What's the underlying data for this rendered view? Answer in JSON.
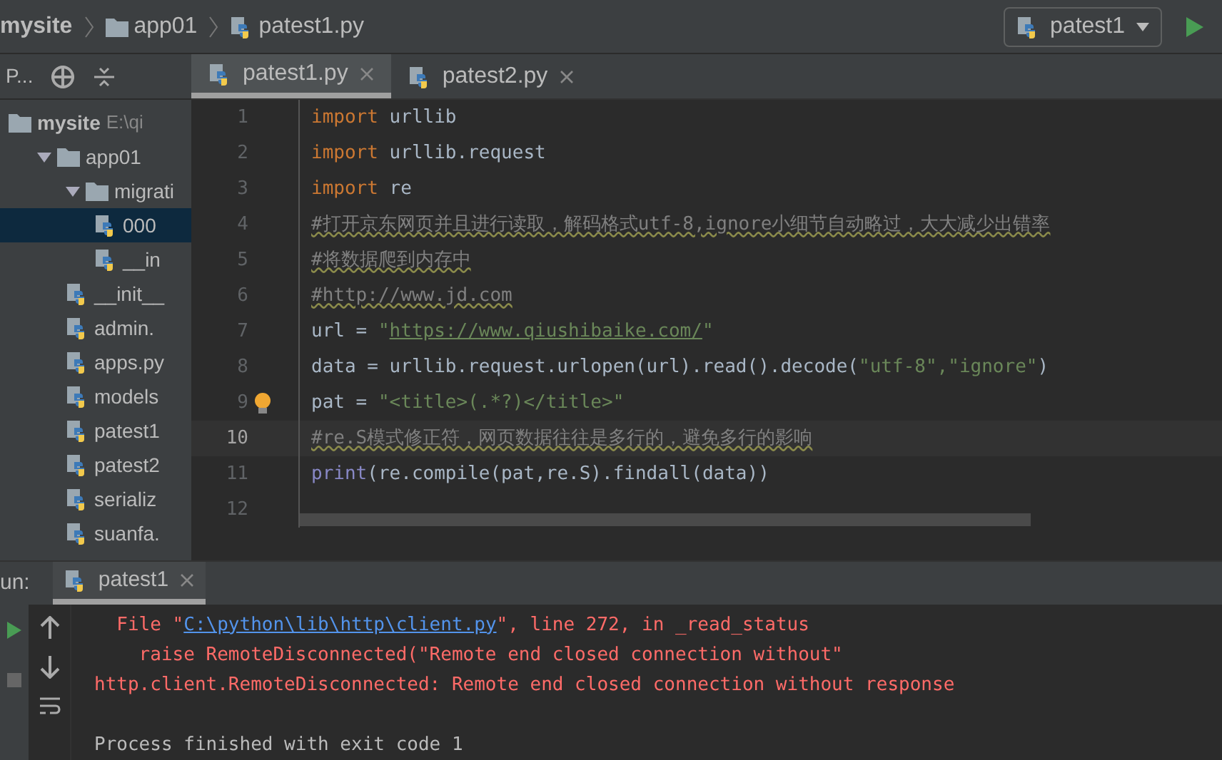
{
  "breadcrumbs": [
    {
      "label": "mysite",
      "kind": "project"
    },
    {
      "label": "app01",
      "kind": "folder"
    },
    {
      "label": "patest1.py",
      "kind": "file"
    }
  ],
  "run_config": {
    "label": "patest1"
  },
  "project_panel": {
    "view_label": "P..."
  },
  "tree": [
    {
      "label": "mysite",
      "path": "E:\\qi",
      "kind": "folder",
      "selected": false,
      "children": [
        {
          "label": "app01",
          "kind": "folder",
          "expanded": true,
          "selected": false,
          "children": [
            {
              "label": "migrati",
              "kind": "folder",
              "expanded": true,
              "selected": false,
              "children": [
                {
                  "label": "000",
                  "kind": "file",
                  "selected": true
                },
                {
                  "label": "__in",
                  "kind": "file",
                  "selected": false
                }
              ]
            },
            {
              "label": "__init__",
              "kind": "file",
              "selected": false
            },
            {
              "label": "admin.",
              "kind": "file",
              "selected": false
            },
            {
              "label": "apps.py",
              "kind": "file",
              "selected": false
            },
            {
              "label": "models",
              "kind": "file",
              "selected": false
            },
            {
              "label": "patest1",
              "kind": "file",
              "selected": false
            },
            {
              "label": "patest2",
              "kind": "file",
              "selected": false
            },
            {
              "label": "serializ",
              "kind": "file",
              "selected": false
            },
            {
              "label": "suanfa.",
              "kind": "file",
              "selected": false
            }
          ]
        }
      ]
    }
  ],
  "editor_tabs": [
    {
      "label": "patest1.py",
      "selected": true
    },
    {
      "label": "patest2.py",
      "selected": false
    }
  ],
  "code": [
    {
      "number": "1",
      "current": false,
      "tokens": [
        {
          "kind": "kw",
          "text": "import"
        },
        {
          "kind": "plain",
          "text": " urllib"
        }
      ]
    },
    {
      "number": "2",
      "current": false,
      "tokens": [
        {
          "kind": "kw",
          "text": "import"
        },
        {
          "kind": "plain",
          "text": " urllib.request"
        }
      ]
    },
    {
      "number": "3",
      "current": false,
      "tokens": [
        {
          "kind": "kw",
          "text": "import"
        },
        {
          "kind": "plain",
          "text": " re"
        }
      ]
    },
    {
      "number": "4",
      "current": false,
      "tokens": [
        {
          "kind": "comment",
          "text": "#打开京东网页并且进行读取，解码格式utf-8,ignore小细节自动略过，大大减少出错率"
        }
      ]
    },
    {
      "number": "5",
      "current": false,
      "tokens": [
        {
          "kind": "comment",
          "text": "#将数据爬到内存中"
        }
      ]
    },
    {
      "number": "6",
      "current": false,
      "tokens": [
        {
          "kind": "comment",
          "text": "#http://www.jd.com"
        }
      ]
    },
    {
      "number": "7",
      "current": false,
      "tokens": [
        {
          "kind": "plain",
          "text": "url = "
        },
        {
          "kind": "str",
          "text": "\""
        },
        {
          "kind": "link",
          "text": "https://www.qiushibaike.com/"
        },
        {
          "kind": "str",
          "text": "\""
        }
      ]
    },
    {
      "number": "8",
      "current": false,
      "tokens": [
        {
          "kind": "plain",
          "text": "data = urllib.request.urlopen(url).read().decode("
        },
        {
          "kind": "str",
          "text": "\"utf-8\",\"ignore\""
        },
        {
          "kind": "plain",
          "text": ")"
        }
      ]
    },
    {
      "number": "9",
      "current": false,
      "bulb": true,
      "tokens": [
        {
          "kind": "plain",
          "text": "pat = "
        },
        {
          "kind": "str",
          "text": "\"<title>(.*?)</title>\""
        }
      ]
    },
    {
      "number": "10",
      "current": true,
      "tokens": [
        {
          "kind": "comment",
          "text": "#re.S模式修正符，网页数据往往是多行的，避免多行的影响"
        }
      ]
    },
    {
      "number": "11",
      "current": false,
      "tokens": [
        {
          "kind": "builtin",
          "text": "print"
        },
        {
          "kind": "plain",
          "text": "(re.compile(pat,re.S).findall(data))"
        }
      ]
    },
    {
      "number": "12",
      "current": false
    }
  ],
  "run_panel": {
    "label": "un:",
    "tabs": [
      {
        "label": "patest1",
        "selected": true
      }
    ]
  },
  "console": [
    {
      "kind": "error",
      "parts": [
        {
          "kind": "text",
          "text": "  File \""
        },
        {
          "kind": "link",
          "text": "C:\\python\\lib\\http\\client.py"
        },
        {
          "kind": "text",
          "text": "\", line 272, in _read_status"
        }
      ]
    },
    {
      "kind": "error",
      "parts": [
        {
          "kind": "text",
          "text": "    raise RemoteDisconnected(\"Remote end closed connection without\""
        }
      ]
    },
    {
      "kind": "error",
      "parts": [
        {
          "kind": "text",
          "text": "http.client.RemoteDisconnected: Remote end closed connection without response"
        }
      ]
    },
    {
      "kind": "blank"
    },
    {
      "kind": "info",
      "parts": [
        {
          "kind": "text",
          "text": "Process finished with exit code 1"
        }
      ]
    }
  ]
}
